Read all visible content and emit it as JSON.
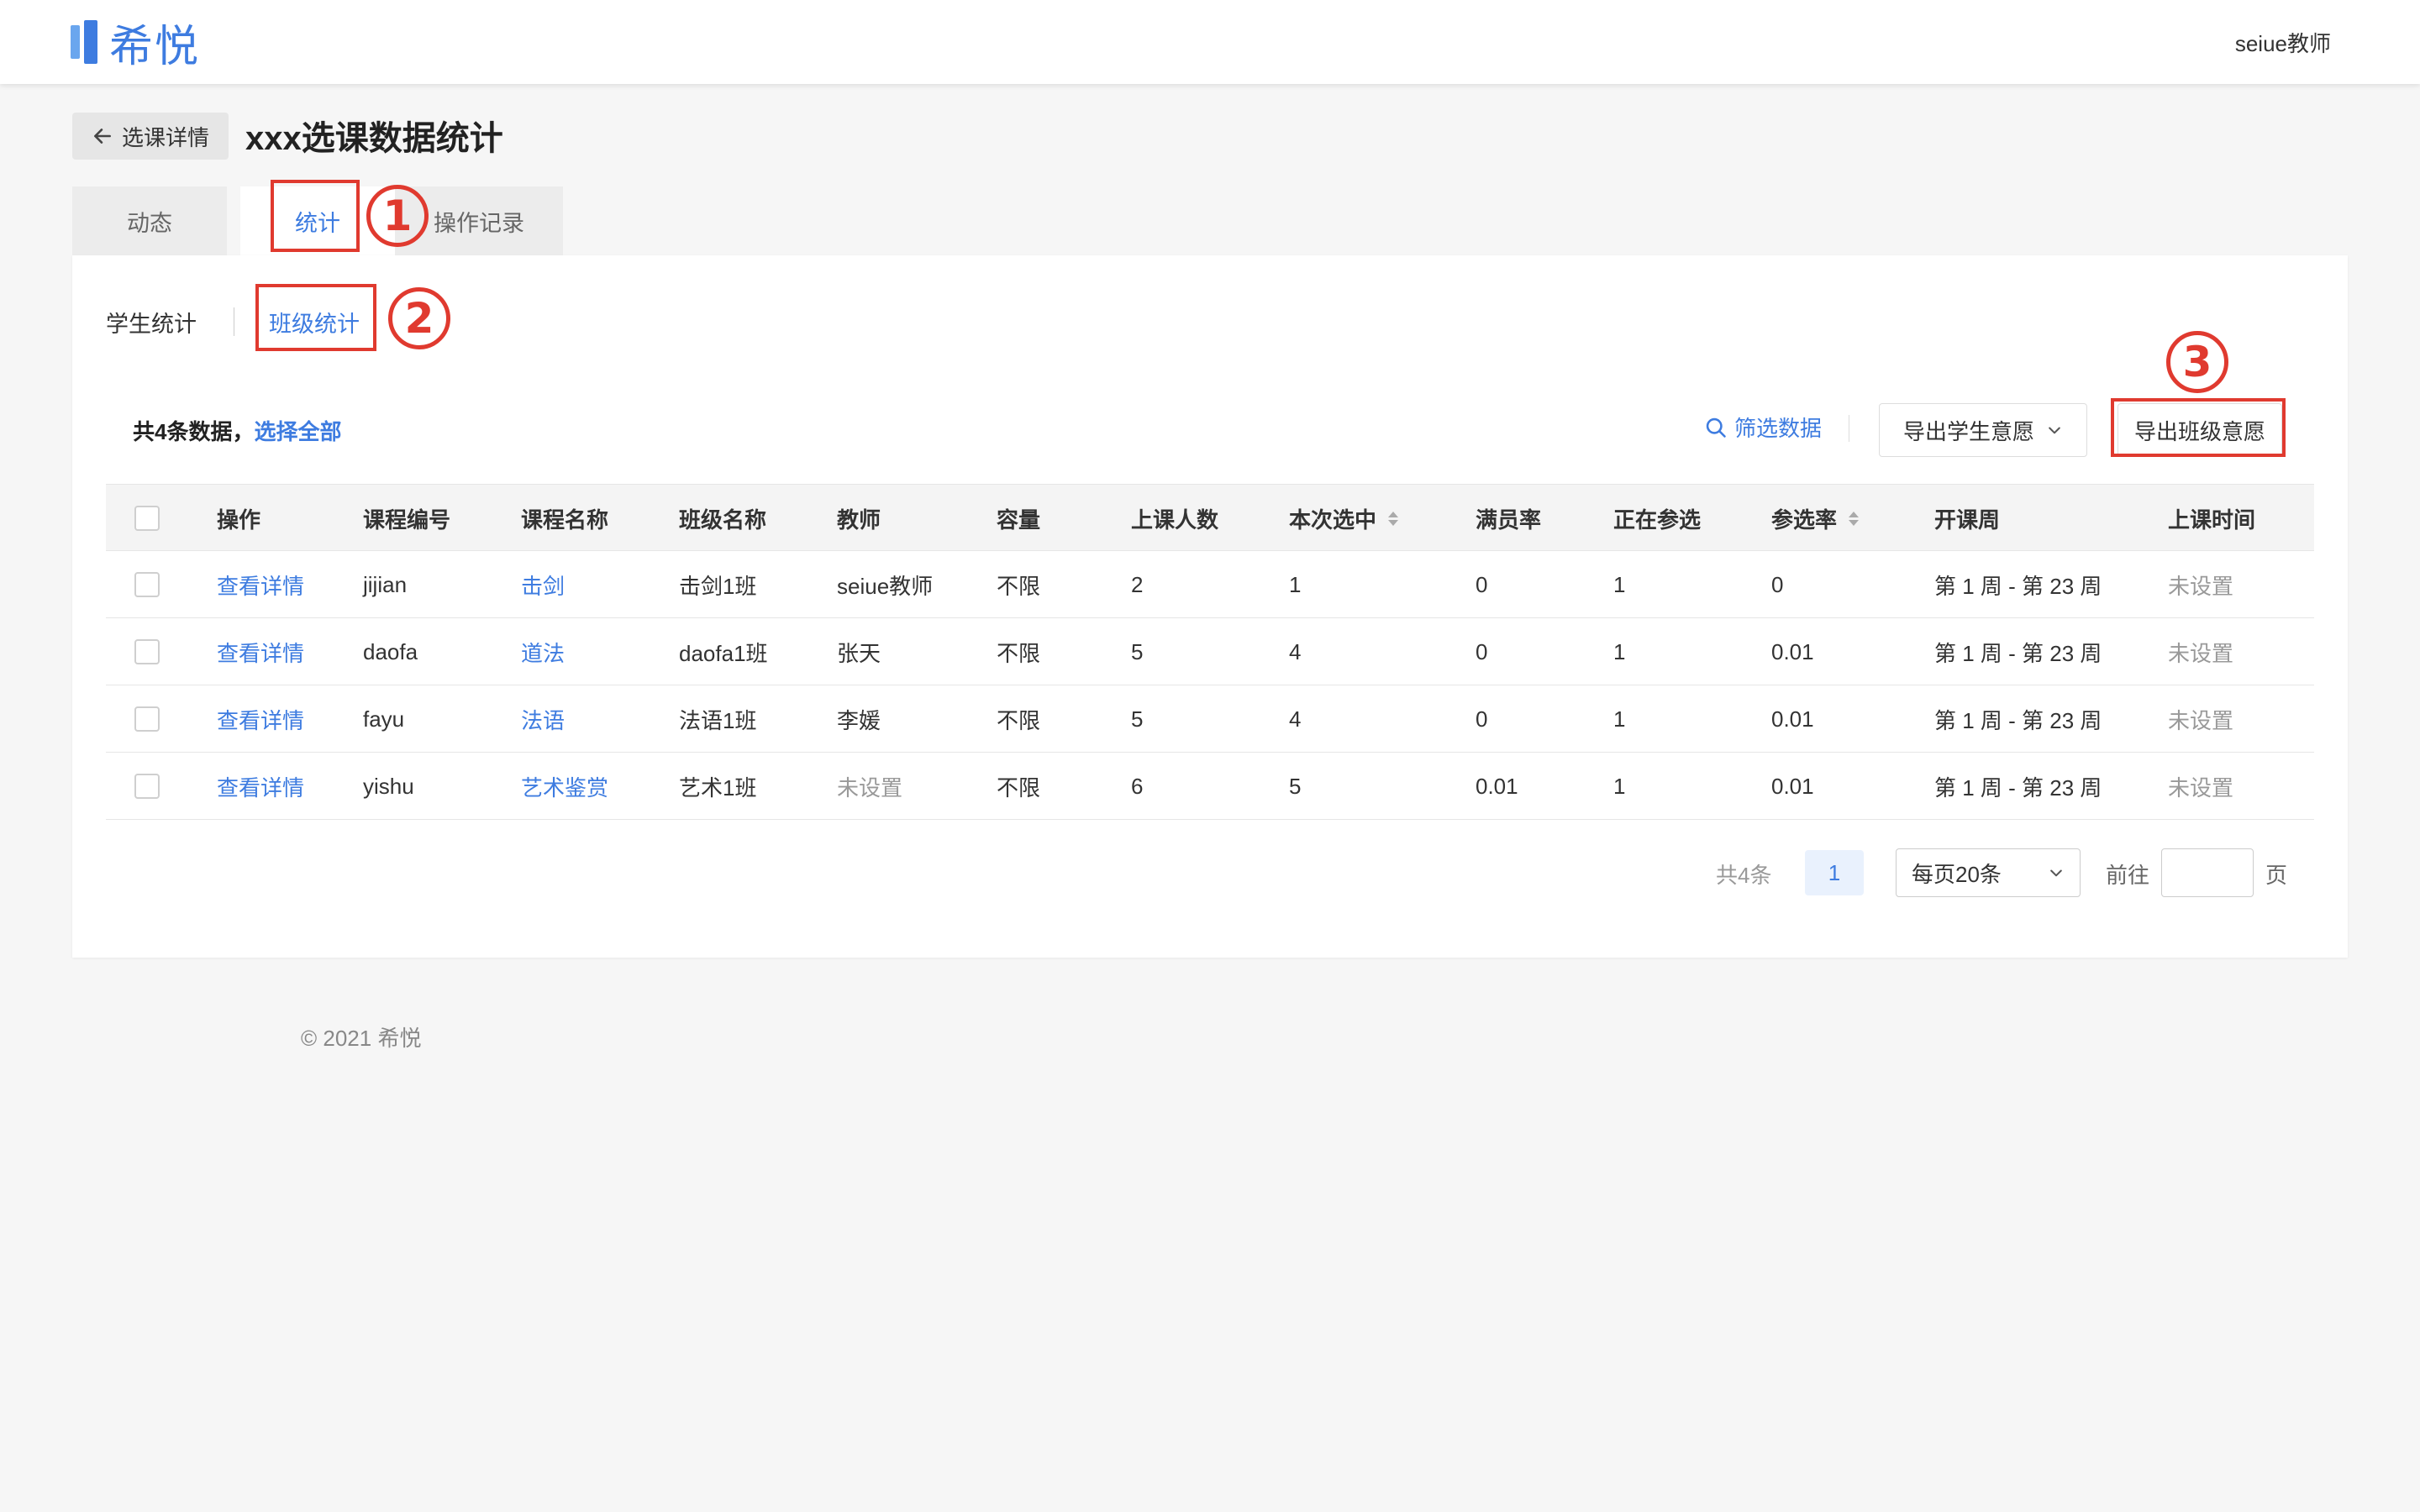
{
  "app": {
    "name": "希悦"
  },
  "header": {
    "user": "seiue教师"
  },
  "page": {
    "back_label": "选课详情",
    "title": "xxx选课数据统计"
  },
  "tabs": [
    {
      "label": "动态"
    },
    {
      "label": "统计"
    },
    {
      "label": "操作记录"
    }
  ],
  "subtabs": [
    {
      "label": "学生统计"
    },
    {
      "label": "班级统计"
    }
  ],
  "summary": {
    "count_text": "共4条数据，",
    "select_all": "选择全部"
  },
  "toolbar": {
    "filter_label": "筛选数据",
    "export_student_label": "导出学生意愿",
    "export_class_label": "导出班级意愿"
  },
  "table": {
    "columns": [
      "操作",
      "课程编号",
      "课程名称",
      "班级名称",
      "教师",
      "容量",
      "上课人数",
      "本次选中",
      "满员率",
      "正在参选",
      "参选率",
      "开课周",
      "上课时间"
    ],
    "rows": [
      {
        "action": "查看详情",
        "code": "jijian",
        "course": "击剑",
        "class": "击剑1班",
        "teacher": "seiue教师",
        "capacity": "不限",
        "enrolled": "2",
        "selected": "1",
        "full_rate": "0",
        "in_progress": "1",
        "rate": "0",
        "weeks": "第 1 周 - 第 23 周",
        "time": "未设置"
      },
      {
        "action": "查看详情",
        "code": "daofa",
        "course": "道法",
        "class": "daofa1班",
        "teacher": "张天",
        "capacity": "不限",
        "enrolled": "5",
        "selected": "4",
        "full_rate": "0",
        "in_progress": "1",
        "rate": "0.01",
        "weeks": "第 1 周 - 第 23 周",
        "time": "未设置"
      },
      {
        "action": "查看详情",
        "code": "fayu",
        "course": "法语",
        "class": "法语1班",
        "teacher": "李媛",
        "capacity": "不限",
        "enrolled": "5",
        "selected": "4",
        "full_rate": "0",
        "in_progress": "1",
        "rate": "0.01",
        "weeks": "第 1 周 - 第 23 周",
        "time": "未设置"
      },
      {
        "action": "查看详情",
        "code": "yishu",
        "course": "艺术鉴赏",
        "class": "艺术1班",
        "teacher": "未设置",
        "capacity": "不限",
        "enrolled": "6",
        "selected": "5",
        "full_rate": "0.01",
        "in_progress": "1",
        "rate": "0.01",
        "weeks": "第 1 周 - 第 23 周",
        "time": "未设置"
      }
    ]
  },
  "pagination": {
    "total": "共4条",
    "current_page": "1",
    "page_size": "每页20条",
    "goto_label": "前往",
    "goto_unit": "页"
  },
  "footer": {
    "copyright": "© 2021 希悦"
  },
  "annotations": {
    "n1": "1",
    "n2": "2",
    "n3": "3"
  },
  "colors": {
    "accent": "#3e7ce0",
    "annotation": "#e03a2f"
  }
}
